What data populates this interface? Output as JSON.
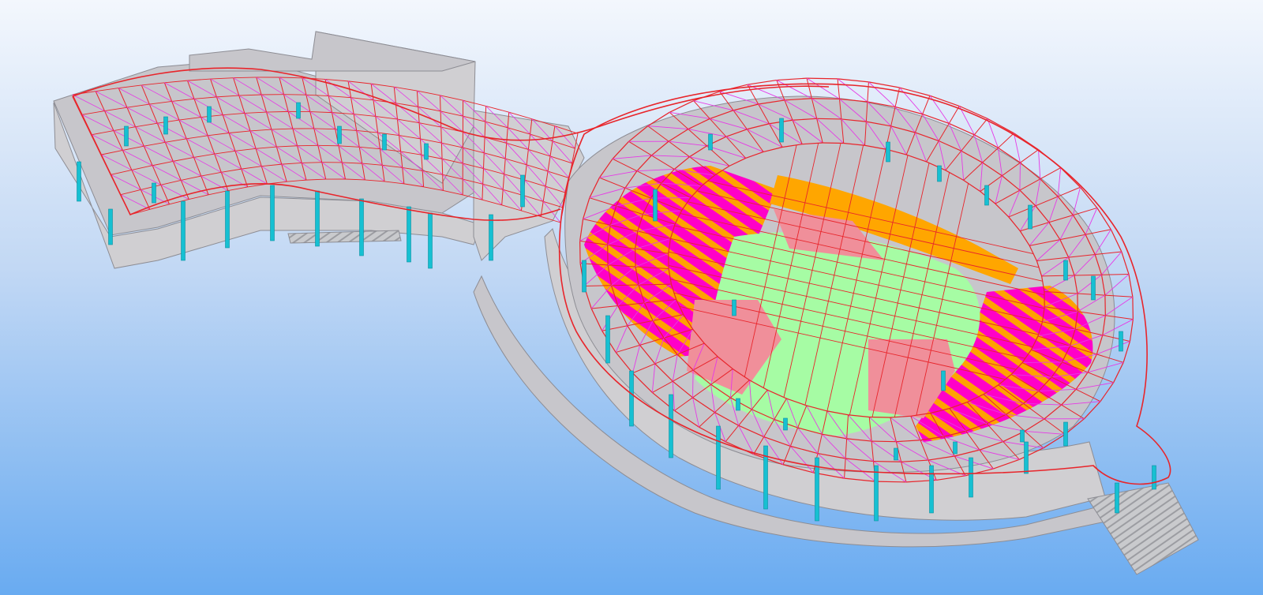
{
  "scene": {
    "colors": {
      "background_top": "#f3f7fd",
      "background_mid": "#c2d8f4",
      "background_bottom": "#69abf1",
      "building_face": "#d0cfd2",
      "building_roof": "#c7c6cb",
      "building_edge": "#8d8d94",
      "column": "#16c0d2",
      "column_shade": "#0c8fa0",
      "truss_chord": "#e8252b",
      "truss_diagonal": "#e63ae6",
      "roof_panel_striped_a": "#ff00c8",
      "roof_panel_striped_b": "#ffa200",
      "roof_panel_orange": "#ffa600",
      "roof_panel_green": "#a6fca4",
      "roof_panel_pink": "#f08f9a",
      "stair": "#bfc0c4"
    },
    "icons": {
      "columns": "column-icon",
      "stairs": "stair-icon"
    }
  }
}
